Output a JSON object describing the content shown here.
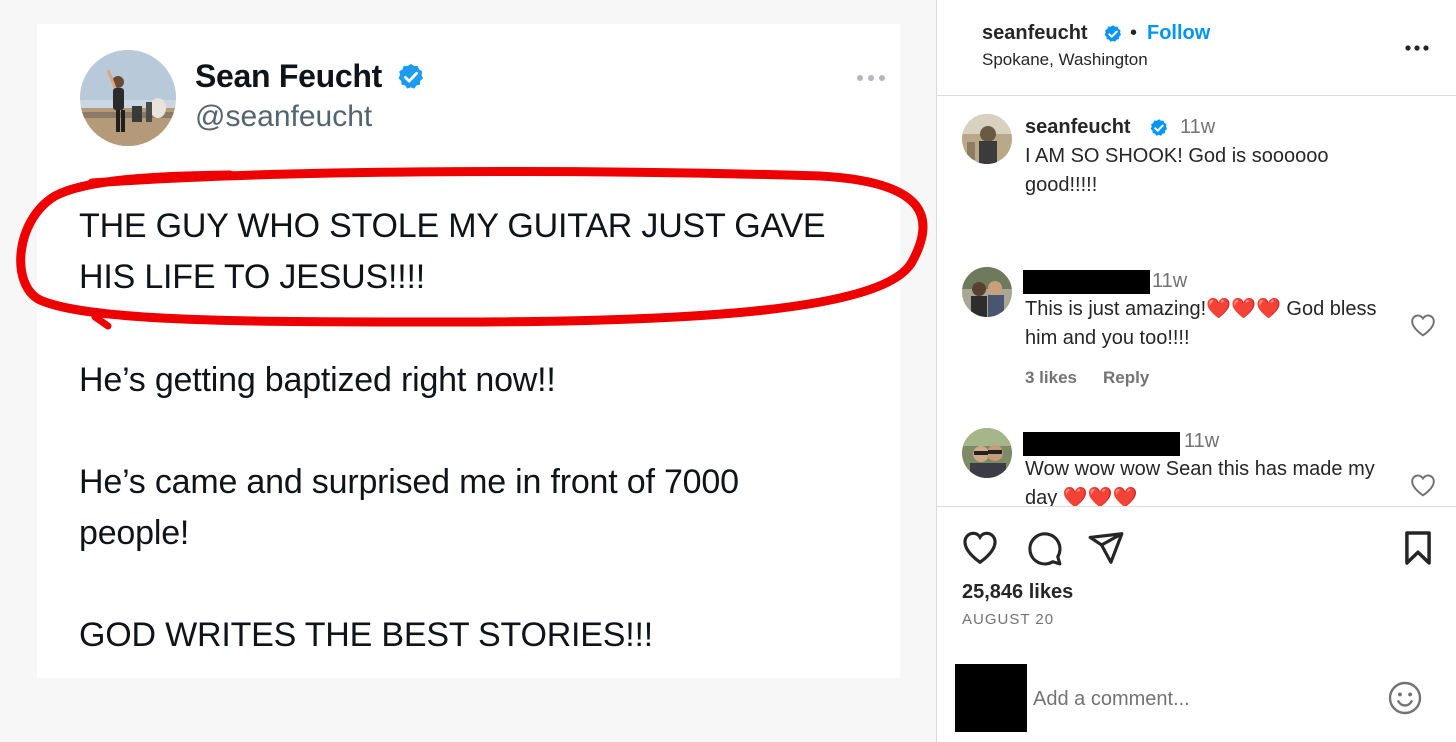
{
  "tweet": {
    "display_name": "Sean Feucht",
    "handle": "@seanfeucht",
    "lines": {
      "l1": "THE GUY WHO STOLE MY GUITAR JUST GAVE",
      "l2": "HIS LIFE TO JESUS!!!!",
      "l3": "He’s getting baptized right now!!",
      "l4": "He’s came and surprised me in front of 7000",
      "l5": "people!",
      "l6": "GOD WRITES THE BEST STORIES!!!"
    },
    "annotation_color": "#ee0000"
  },
  "header": {
    "username": "seanfeucht",
    "separator": "•",
    "follow_label": "Follow",
    "location": "Spokane, Washington"
  },
  "comments": {
    "caption": {
      "username": "seanfeucht",
      "time": "11w",
      "text": "I AM SO SHOOK! God is soooooo good!!!!!"
    },
    "c1": {
      "time": "11w",
      "text": "This is just amazing!❤️❤️❤️ God bless him and you too!!!!",
      "likes": "3 likes",
      "reply": "Reply"
    },
    "c2": {
      "time": "11w",
      "text": "Wow wow wow Sean this has made my day ❤️❤️❤️"
    }
  },
  "actions": {
    "likes": "25,846 likes",
    "date": "AUGUST 20"
  },
  "comment_box": {
    "placeholder": "Add a comment..."
  },
  "colors": {
    "accent": "#0095f6",
    "verified": "#0095f6",
    "twitter_verified": "#1d9bf0",
    "heart": "#ed4956"
  }
}
